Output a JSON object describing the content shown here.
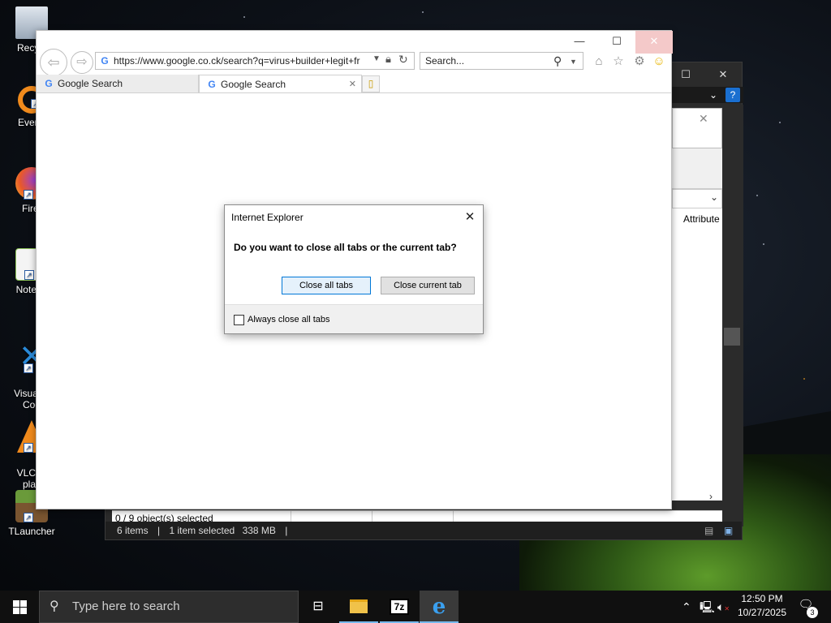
{
  "desktop": {
    "icons": [
      {
        "label": "Recycl",
        "icon": "recycle-bin-icon",
        "color": "#9aa8b8"
      },
      {
        "label": "Everyt",
        "icon": "everything-search-icon",
        "color": "#f08a1c"
      },
      {
        "label": "Firef",
        "icon": "firefox-icon",
        "color": "#e8582a"
      },
      {
        "label": "Notepa",
        "icon": "notepad-plus-plus-icon",
        "color": "#8fc55a"
      },
      {
        "label": "Visual S\nCod",
        "icon": "vscode-icon",
        "color": "#2a8ad8"
      },
      {
        "label": "VLC m\nplay",
        "icon": "vlc-icon",
        "color": "#f08a1c"
      },
      {
        "label": "TLauncher",
        "icon": "tlauncher-icon",
        "color": "#6a9a3a"
      }
    ]
  },
  "explorer": {
    "column_header": "Attribute",
    "selected_objects": "0 / 9 object(s) selected",
    "status": {
      "items": "6 items",
      "selected": "1 item selected",
      "size": "338 MB"
    }
  },
  "ie": {
    "address_url": "https://www.google.co.ck/search?q=virus+builder+legit+fr",
    "search_placeholder": "Search...",
    "tabs": [
      {
        "label": "Google Search",
        "active": false
      },
      {
        "label": "Google Search",
        "active": true
      }
    ]
  },
  "dialog": {
    "title": "Internet Explorer",
    "question": "Do you want to close all tabs or the current tab?",
    "close_all_label": "Close all tabs",
    "close_current_label": "Close current tab",
    "checkbox_label": "Always close all tabs",
    "checkbox_checked": false
  },
  "taskbar": {
    "search_placeholder": "Type here to search",
    "apps": [
      "task-view-icon",
      "file-explorer-icon",
      "7zip-icon",
      "internet-explorer-icon"
    ],
    "apps_labels": {
      "sevenzip": "7z"
    },
    "clock_time": "12:50 PM",
    "clock_date": "10/27/2025",
    "notification_count": "3"
  }
}
